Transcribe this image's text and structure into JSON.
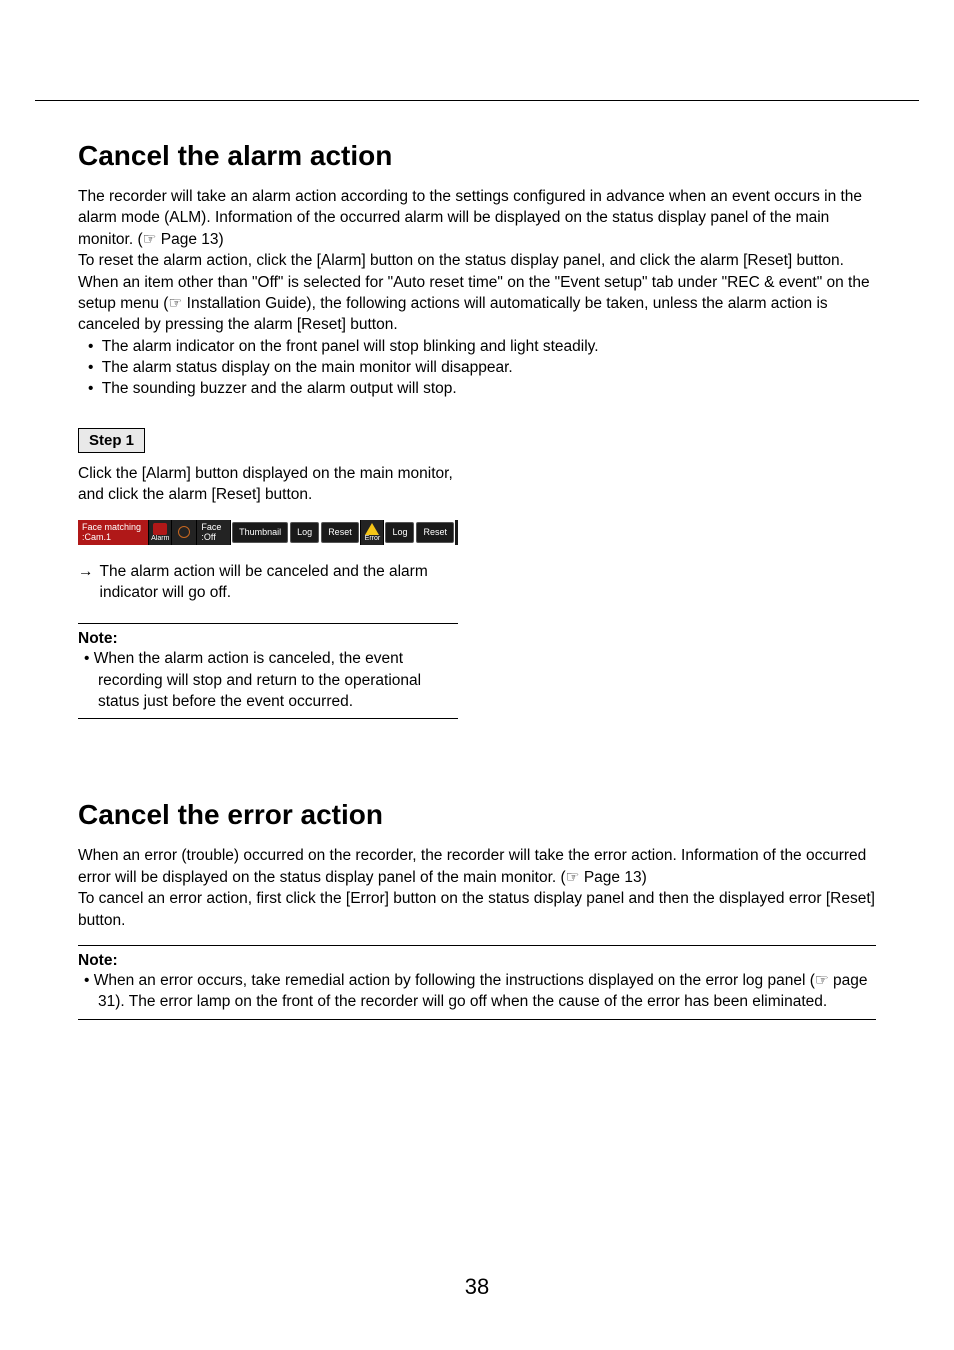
{
  "section1": {
    "heading": "Cancel the alarm action",
    "intro": "The recorder will take an alarm action according to the settings configured in advance when an event occurs in the alarm mode (ALM). Information of the occurred alarm will be displayed on the status display panel of the main monitor. (☞ Page 13)\nTo reset the alarm action, click the [Alarm] button on the status display panel, and click the alarm [Reset] button.\nWhen an item other than \"Off\" is selected for \"Auto reset time\" on the \"Event setup\" tab under \"REC & event\" on the setup menu (☞ Installation Guide), the following actions will automatically be taken, unless the alarm action is canceled by pressing the alarm [Reset] button.",
    "bullets": [
      "The alarm indicator on the front panel will stop blinking and light steadily.",
      "The alarm status display on the main monitor will disappear.",
      "The sounding buzzer and the alarm output will stop."
    ],
    "step_label": "Step 1",
    "step_text": "Click the [Alarm] button displayed on the main monitor, and click the alarm [Reset] button.",
    "result": "The alarm action will be canceled and the alarm indicator will go off.",
    "note_label": "Note:",
    "note_text": "When the alarm action is canceled, the event recording will stop and return to the operational status just before the event occurred."
  },
  "statusbar": {
    "face_matching": "Face matching :Cam.1",
    "alarm_label": "Alarm",
    "face_off": "Face :Off",
    "thumbnail": "Thumbnail",
    "log1": "Log",
    "reset1": "Reset",
    "error_label": "Error",
    "log2": "Log",
    "reset2": "Reset"
  },
  "section2": {
    "heading": "Cancel the error action",
    "intro": "When an error (trouble) occurred on the recorder, the recorder will take the error action. Information of the occurred error will be displayed on the status display panel of the main monitor. (☞ Page 13)\nTo cancel an error action, first click the [Error] button on the status display panel and then the displayed error [Reset] button.",
    "note_label": "Note:",
    "note_text": "When an error occurs, take remedial action by following the instructions displayed on the error log panel (☞ page 31). The error lamp on the front of the recorder will go off when the cause of the error has been eliminated."
  },
  "page_number": "38"
}
